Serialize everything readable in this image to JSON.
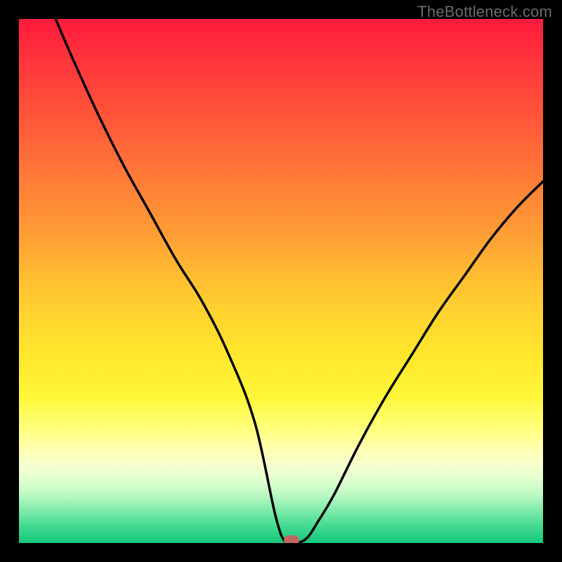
{
  "watermark": "TheBottleneck.com",
  "chart_data": {
    "type": "line",
    "title": "",
    "xlabel": "",
    "ylabel": "",
    "xlim": [
      0,
      100
    ],
    "ylim": [
      0,
      100
    ],
    "grid": false,
    "series": [
      {
        "name": "bottleneck-curve",
        "x": [
          7,
          10,
          15,
          20,
          25,
          30,
          35,
          40,
          45,
          49,
          51,
          53,
          55,
          57,
          60,
          65,
          70,
          75,
          80,
          85,
          90,
          95,
          100
        ],
        "values": [
          100,
          93,
          82,
          72,
          63,
          54,
          46,
          36,
          23,
          5,
          0,
          0,
          1,
          4,
          9,
          19,
          28,
          36,
          44,
          51,
          58,
          64,
          69
        ]
      }
    ],
    "marker": {
      "x": 52,
      "y": 0,
      "name": "optimal-point"
    },
    "background": "rainbow-vertical-gradient"
  },
  "colors": {
    "curve": "#000000",
    "marker": "#c1675f",
    "frame": "#000000",
    "watermark": "#6b6b6b"
  }
}
